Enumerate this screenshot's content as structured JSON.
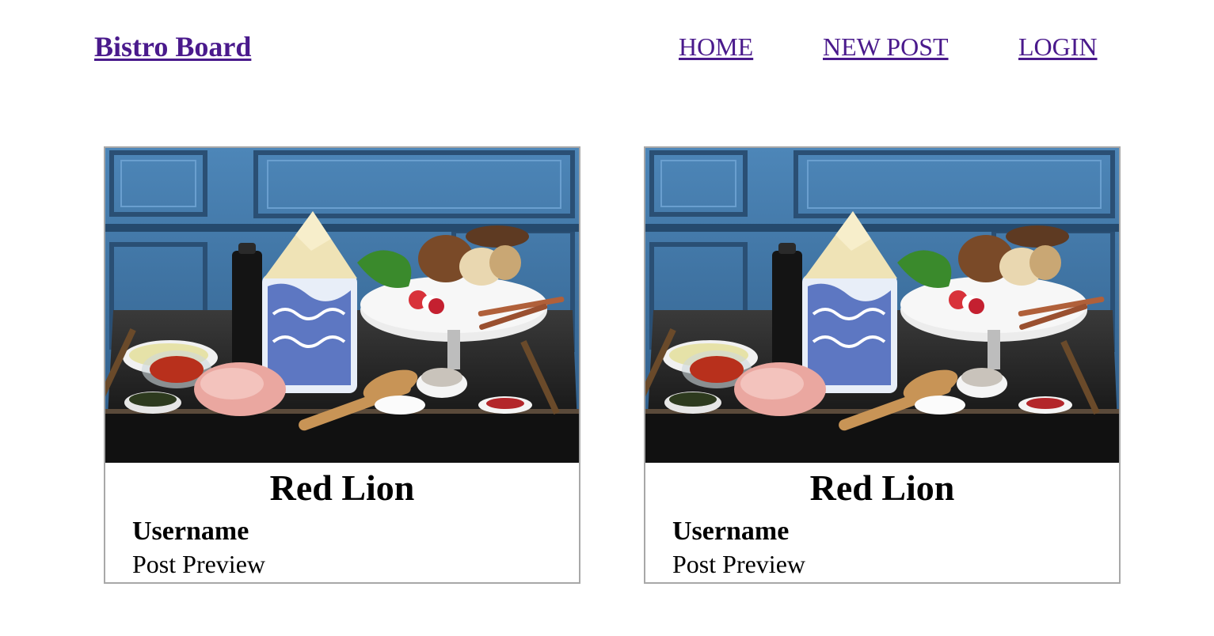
{
  "navbar": {
    "brand": "Bistro Board",
    "links": [
      "HOME",
      "NEW POST",
      "LOGIN"
    ]
  },
  "posts": [
    {
      "title": "Red Lion",
      "username": "Username",
      "preview": "Post Preview"
    },
    {
      "title": "Red Lion",
      "username": "Username",
      "preview": "Post Preview"
    }
  ],
  "colors": {
    "link": "#4a1a8c",
    "card_border": "#a8a8a8",
    "wall_blue": "#3a6f9c"
  },
  "image": {
    "subject": "food-tray-photo"
  }
}
